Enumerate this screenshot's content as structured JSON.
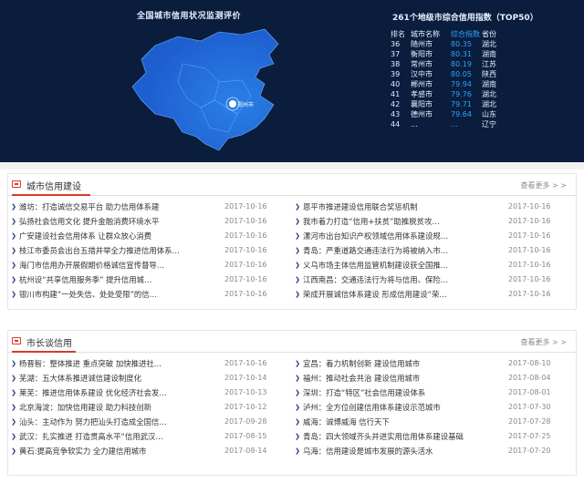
{
  "dashboard": {
    "map_title": "全国城市信用状况监测评价",
    "map_label": "郑州市",
    "ranking_title": "261个地级市综合信用指数（TOP50）",
    "ranking_headers": {
      "rank": "排名",
      "city": "城市名称",
      "score": "综合指数",
      "province": "省份"
    },
    "ranking": [
      {
        "rank": "36",
        "city": "随州市",
        "score": "80.35",
        "province": "湖北"
      },
      {
        "rank": "37",
        "city": "衡阳市",
        "score": "80.31",
        "province": "湖南"
      },
      {
        "rank": "38",
        "city": "常州市",
        "score": "80.19",
        "province": "江苏"
      },
      {
        "rank": "39",
        "city": "汉中市",
        "score": "80.05",
        "province": "陕西"
      },
      {
        "rank": "40",
        "city": "郴州市",
        "score": "79.94",
        "province": "湖南"
      },
      {
        "rank": "41",
        "city": "孝感市",
        "score": "79.76",
        "province": "湖北"
      },
      {
        "rank": "42",
        "city": "襄阳市",
        "score": "79.71",
        "province": "湖北"
      },
      {
        "rank": "43",
        "city": "德州市",
        "score": "79.64",
        "province": "山东"
      },
      {
        "rank": "44",
        "city": "…",
        "score": "…",
        "province": "辽宁"
      }
    ]
  },
  "section1": {
    "title": "城市信用建设",
    "more": "查看更多 > >",
    "left": [
      {
        "title": "潍坊：打造诚信交易平台 助力信用体系建",
        "date": "2017-10-16"
      },
      {
        "title": "弘扬社会信用文化 提升金融消费环境水平",
        "date": "2017-10-16"
      },
      {
        "title": "广安建设社会信用体系 让群众放心消费",
        "date": "2017-10-16"
      },
      {
        "title": "枝江市委员会出台五措并举全力推进信用体系…",
        "date": "2017-10-16"
      },
      {
        "title": "海门市信用办开展假期价格诚信宣传督导…",
        "date": "2017-10-16"
      },
      {
        "title": "杭州设“共享信用服务季” 提升信用城…",
        "date": "2017-10-16"
      },
      {
        "title": "银川市构建“一处失信、处处受限”的信…",
        "date": "2017-10-16"
      }
    ],
    "right": [
      {
        "title": "恩平市推进建设信用联合奖惩机制",
        "date": "2017-10-16"
      },
      {
        "title": "我市着力打造“信用+扶贫”助推脱贫攻…",
        "date": "2017-10-16"
      },
      {
        "title": "漯河市出台知识产权领域信用体系建设规…",
        "date": "2017-10-16"
      },
      {
        "title": "青岛：严重道路交通违法行为将被纳入市…",
        "date": "2017-10-16"
      },
      {
        "title": "义乌市场主体信用监管机制建设获全国推…",
        "date": "2017-10-16"
      },
      {
        "title": "江西南昌：交通违法行为将与信用、保险…",
        "date": "2017-10-16"
      },
      {
        "title": "荣成开展诚信体系建设 形成信用建设“荣…",
        "date": "2017-10-16"
      }
    ]
  },
  "section2": {
    "title": "市长谈信用",
    "more": "查看更多 > >",
    "left": [
      {
        "title": "杨晋智：整体推进 重点突破 加快推进社…",
        "date": "2017-10-16"
      },
      {
        "title": "芜湖：五大体系推进诚信建设制度化",
        "date": "2017-10-14"
      },
      {
        "title": "莱芜：推进信用体系建设 优化经济社会发…",
        "date": "2017-10-13"
      },
      {
        "title": "北京海淀：加快信用建设 助力科技创新",
        "date": "2017-10-12"
      },
      {
        "title": "汕头：主动作为 努力把汕头打造成全国信…",
        "date": "2017-09-28"
      },
      {
        "title": "武汉：扎实推进 打造贯高水平“信用武汉…",
        "date": "2017-08-15"
      },
      {
        "title": "黄石:提高竞争软实力 全力建信用城市",
        "date": "2017-08-14"
      }
    ],
    "right": [
      {
        "title": "宜昌：着力机制创新 建设信用城市",
        "date": "2017-08-10"
      },
      {
        "title": "福州：推动社会共治 建设信用城市",
        "date": "2017-08-04"
      },
      {
        "title": "深圳：打造“特区”社会信用建设体系",
        "date": "2017-08-01"
      },
      {
        "title": "泸州：全方位创建信用体系建设示范城市",
        "date": "2017-07-30"
      },
      {
        "title": "威海：诚博威海 信行天下",
        "date": "2017-07-28"
      },
      {
        "title": "青岛：四大领域齐头并进实用信用体系建设基础",
        "date": "2017-07-25"
      },
      {
        "title": "乌海：信用建设是城市发展的源头活水",
        "date": "2017-07-20"
      }
    ]
  }
}
